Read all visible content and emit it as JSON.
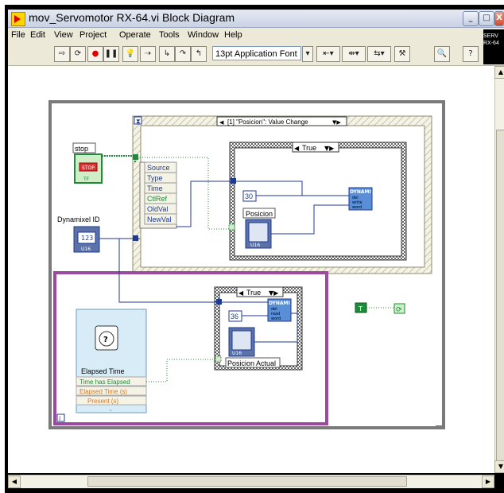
{
  "window": {
    "title": "mov_Servomotor RX-64.vi Block Diagram"
  },
  "menu": [
    "File",
    "Edit",
    "View",
    "Project",
    "Operate",
    "Tools",
    "Window",
    "Help"
  ],
  "toolbar": {
    "font": "13pt Application Font"
  },
  "side_label": {
    "line1": "SERV",
    "line2": "RX-64"
  },
  "diagram": {
    "stop_label": "stop",
    "stop_button": "STOP",
    "stop_tf": "TF",
    "dyn_label": "Dynamixel ID",
    "dyn_value": "123",
    "event_selector": "[1] \"Posicion\": Value Change",
    "event_fields": [
      "Source",
      "Type",
      "Time",
      "CtlRef",
      "OldVal",
      "NewVal"
    ],
    "case_true_1": "True",
    "const_30": "30",
    "posicion_label": "Posicion",
    "dynami_1": [
      "DYNAMI",
      "del",
      "write",
      "word"
    ],
    "case_true_2": "True",
    "const_36": "36",
    "dynami_2": [
      "DYNAMI",
      "del",
      "read",
      "word"
    ],
    "posicion_actual_label": "Posicion Actual",
    "elapsed_title": "Elapsed Time",
    "elapsed_outputs": [
      "Time has Elapsed",
      "Elapsed Time (s)",
      "Present (s)"
    ],
    "bool_const": "T",
    "u16": "U16",
    "loop_index": "i"
  },
  "colors": {
    "loop_border": "#7a7a7a",
    "highlight_border": "#9b4aa0",
    "wire_numeric": "#1f3a93",
    "wire_boolean": "#1f8a3a",
    "event_structure": "#efefe2"
  }
}
